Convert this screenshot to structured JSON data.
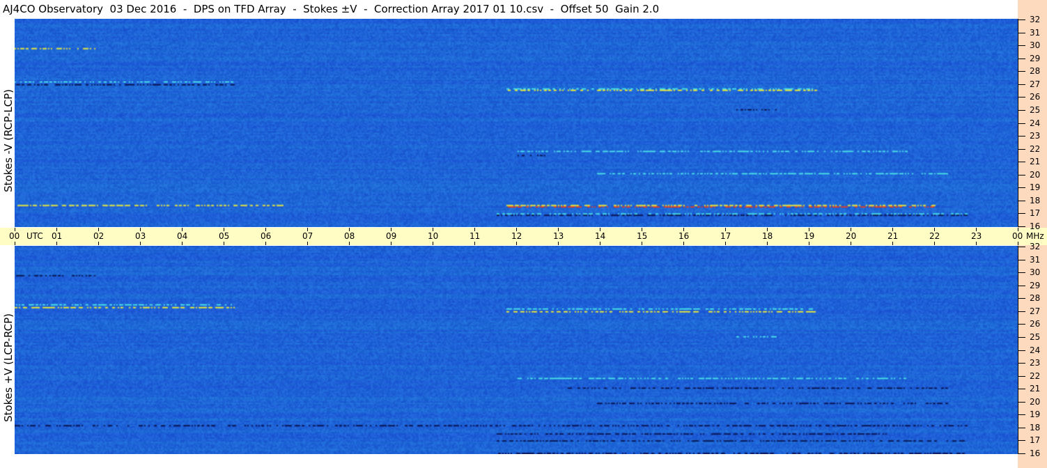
{
  "title": "AJ4CO Observatory  03 Dec 2016  -  DPS on TFD Array  -  Stokes ±V  -  Correction Array 2017 01 10.csv  -  Offset 50  Gain 2.0",
  "chart_data": [
    {
      "type": "heatmap",
      "name": "Stokes -V (RCP-LCP)",
      "ylabel": "Stokes -V (RCP-LCP)",
      "x_ticks": [
        "00",
        "01",
        "02",
        "03",
        "04",
        "05",
        "06",
        "07",
        "08",
        "09",
        "10",
        "11",
        "12",
        "13",
        "14",
        "15",
        "16",
        "17",
        "18",
        "19",
        "20",
        "21",
        "22",
        "23",
        "00"
      ],
      "x_unit": "UTC",
      "y_ticks": [
        "16",
        "17",
        "18",
        "19",
        "20",
        "21",
        "22",
        "23",
        "24",
        "25",
        "26",
        "27",
        "28",
        "29",
        "30",
        "31",
        "32"
      ],
      "y_unit": "MHz",
      "ylim": [
        16,
        32
      ],
      "xlim_hours": [
        0,
        24
      ]
    },
    {
      "type": "heatmap",
      "name": "Stokes +V (LCP-RCP)",
      "ylabel": "Stokes +V (LCP-RCP)",
      "x_ticks": [
        "00",
        "01",
        "02",
        "03",
        "04",
        "05",
        "06",
        "07",
        "08",
        "09",
        "10",
        "11",
        "12",
        "13",
        "14",
        "15",
        "16",
        "17",
        "18",
        "19",
        "20",
        "21",
        "22",
        "23",
        "00"
      ],
      "x_unit": "UTC",
      "y_ticks": [
        "16",
        "17",
        "18",
        "19",
        "20",
        "21",
        "22",
        "23",
        "24",
        "25",
        "26",
        "27",
        "28",
        "29",
        "30",
        "31",
        "32"
      ],
      "y_unit": "MHz",
      "ylim": [
        16,
        32
      ],
      "xlim_hours": [
        0,
        24
      ]
    }
  ],
  "colors": {
    "background_field": "#1f63d8",
    "time_band": "#fffdc4",
    "freq_strip": "#fdd9bd"
  }
}
